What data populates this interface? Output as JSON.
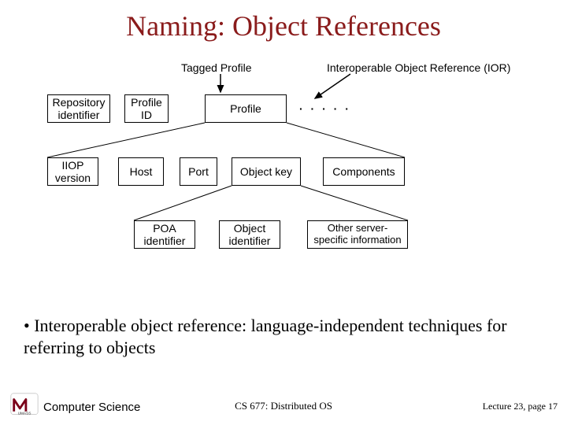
{
  "title": "Naming: Object References",
  "diagram": {
    "tagged_profile": "Tagged Profile",
    "ior_label": "Interoperable Object Reference (IOR)",
    "row1": {
      "repo": "Repository\nidentifier",
      "profile_id": "Profile\nID",
      "profile": "Profile",
      "dots": "·  ·  ·  ·  ·"
    },
    "row2": {
      "iiop": "IIOP\nversion",
      "host": "Host",
      "port": "Port",
      "objkey": "Object key",
      "components": "Components"
    },
    "row3": {
      "poa": "POA\nidentifier",
      "objid": "Object\nidentifier",
      "other": "Other server-\nspecific information"
    }
  },
  "bullet_text": "Interoperable object reference: language-independent techniques for referring to objects",
  "footer": {
    "dept": "Computer Science",
    "course": "CS 677: Distributed OS",
    "lecture": "Lecture 23, page 17"
  }
}
